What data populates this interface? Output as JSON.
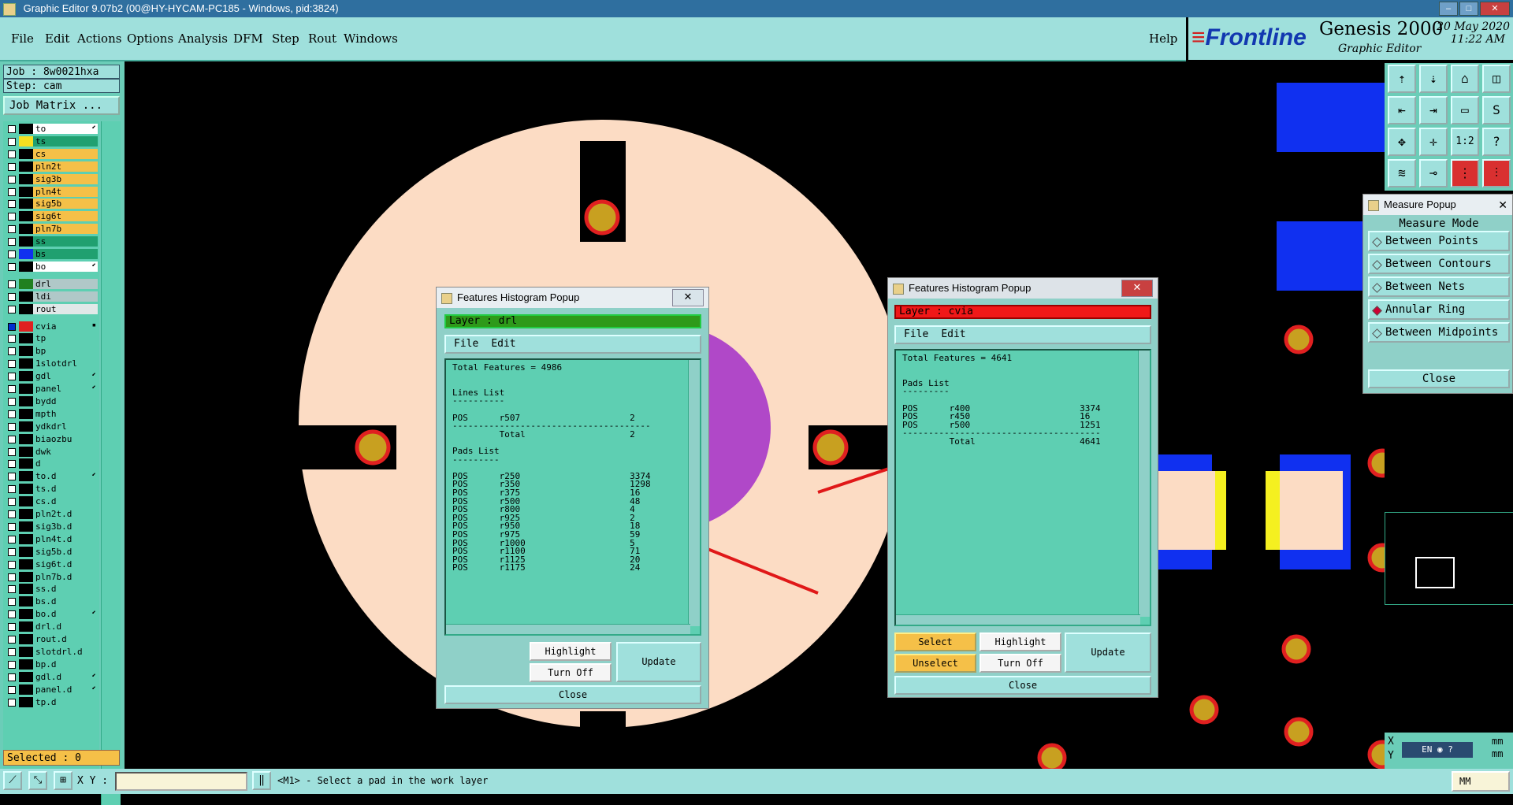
{
  "titlebar": {
    "text": "Graphic Editor 9.07b2 (00@HY-HYCAM-PC185 - Windows, pid:3824)"
  },
  "menu": {
    "items": [
      "File",
      "Edit",
      "Actions",
      "Options",
      "Analysis",
      "DFM",
      "Step",
      "Rout",
      "Windows"
    ],
    "help": "Help"
  },
  "brand": {
    "logo": "Frontline",
    "product": "Genesis 2000",
    "subtitle": "Graphic Editor",
    "date": "20 May 2020",
    "time": "11:22 AM"
  },
  "job": {
    "job_label": "Job  :  8w0021hxa",
    "step_label": "Step:  cam",
    "matrix_button": "Job Matrix ..."
  },
  "layers": [
    {
      "name": "to",
      "swatch": "#000000",
      "bg": "#ffffff",
      "mark": "⬋"
    },
    {
      "name": "ts",
      "swatch": "#f5e020",
      "bg": "#20a070",
      "mark": ""
    },
    {
      "name": "cs",
      "swatch": "#000000",
      "bg": "#f5c048",
      "mark": ""
    },
    {
      "name": "pln2t",
      "swatch": "#000000",
      "bg": "#f5c048",
      "mark": ""
    },
    {
      "name": "sig3b",
      "swatch": "#000000",
      "bg": "#f5c048",
      "mark": ""
    },
    {
      "name": "pln4t",
      "swatch": "#000000",
      "bg": "#f5c048",
      "mark": ""
    },
    {
      "name": "sig5b",
      "swatch": "#000000",
      "bg": "#f5c048",
      "mark": ""
    },
    {
      "name": "sig6t",
      "swatch": "#000000",
      "bg": "#f5c048",
      "mark": ""
    },
    {
      "name": "pln7b",
      "swatch": "#000000",
      "bg": "#f5c048",
      "mark": ""
    },
    {
      "name": "ss",
      "swatch": "#000000",
      "bg": "#20a070",
      "mark": ""
    },
    {
      "name": "bs",
      "swatch": "#1030f0",
      "bg": "#20a070",
      "mark": ""
    },
    {
      "name": "bo",
      "swatch": "#000000",
      "bg": "#ffffff",
      "mark": "⬋"
    },
    {
      "name": "drl",
      "swatch": "#208020",
      "bg": "#b0c8c8",
      "mark": ""
    },
    {
      "name": "ldi",
      "swatch": "#000000",
      "bg": "#b0c8c8",
      "mark": ""
    },
    {
      "name": "rout",
      "swatch": "#000000",
      "bg": "#e0e8e8",
      "mark": ""
    },
    {
      "name": "cvia",
      "swatch": "#e02020",
      "bg": "#5ecfb2",
      "mark": "▪"
    },
    {
      "name": "tp",
      "swatch": "#000000",
      "bg": "#5ecfb2",
      "mark": ""
    },
    {
      "name": "bp",
      "swatch": "#000000",
      "bg": "#5ecfb2",
      "mark": ""
    },
    {
      "name": "1slotdrl",
      "swatch": "#000000",
      "bg": "#5ecfb2",
      "mark": ""
    },
    {
      "name": "gdl",
      "swatch": "#000000",
      "bg": "#5ecfb2",
      "mark": "⬋"
    },
    {
      "name": "panel",
      "swatch": "#000000",
      "bg": "#5ecfb2",
      "mark": "⬋"
    },
    {
      "name": "bydd",
      "swatch": "#000000",
      "bg": "#5ecfb2",
      "mark": ""
    },
    {
      "name": "mpth",
      "swatch": "#000000",
      "bg": "#5ecfb2",
      "mark": ""
    },
    {
      "name": "ydkdrl",
      "swatch": "#000000",
      "bg": "#5ecfb2",
      "mark": ""
    },
    {
      "name": "biaozbu",
      "swatch": "#000000",
      "bg": "#5ecfb2",
      "mark": ""
    },
    {
      "name": "dwk",
      "swatch": "#000000",
      "bg": "#5ecfb2",
      "mark": ""
    },
    {
      "name": "d",
      "swatch": "#000000",
      "bg": "#5ecfb2",
      "mark": ""
    },
    {
      "name": "to.d",
      "swatch": "#000000",
      "bg": "#5ecfb2",
      "mark": "⬋"
    },
    {
      "name": "ts.d",
      "swatch": "#000000",
      "bg": "#5ecfb2",
      "mark": ""
    },
    {
      "name": "cs.d",
      "swatch": "#000000",
      "bg": "#5ecfb2",
      "mark": ""
    },
    {
      "name": "pln2t.d",
      "swatch": "#000000",
      "bg": "#5ecfb2",
      "mark": ""
    },
    {
      "name": "sig3b.d",
      "swatch": "#000000",
      "bg": "#5ecfb2",
      "mark": ""
    },
    {
      "name": "pln4t.d",
      "swatch": "#000000",
      "bg": "#5ecfb2",
      "mark": ""
    },
    {
      "name": "sig5b.d",
      "swatch": "#000000",
      "bg": "#5ecfb2",
      "mark": ""
    },
    {
      "name": "sig6t.d",
      "swatch": "#000000",
      "bg": "#5ecfb2",
      "mark": ""
    },
    {
      "name": "pln7b.d",
      "swatch": "#000000",
      "bg": "#5ecfb2",
      "mark": ""
    },
    {
      "name": "ss.d",
      "swatch": "#000000",
      "bg": "#5ecfb2",
      "mark": ""
    },
    {
      "name": "bs.d",
      "swatch": "#000000",
      "bg": "#5ecfb2",
      "mark": ""
    },
    {
      "name": "bo.d",
      "swatch": "#000000",
      "bg": "#5ecfb2",
      "mark": "⬋"
    },
    {
      "name": "drl.d",
      "swatch": "#000000",
      "bg": "#5ecfb2",
      "mark": ""
    },
    {
      "name": "rout.d",
      "swatch": "#000000",
      "bg": "#5ecfb2",
      "mark": ""
    },
    {
      "name": "slotdrl.d",
      "swatch": "#000000",
      "bg": "#5ecfb2",
      "mark": ""
    },
    {
      "name": "bp.d",
      "swatch": "#000000",
      "bg": "#5ecfb2",
      "mark": ""
    },
    {
      "name": "gdl.d",
      "swatch": "#000000",
      "bg": "#5ecfb2",
      "mark": "⬋"
    },
    {
      "name": "panel.d",
      "swatch": "#000000",
      "bg": "#5ecfb2",
      "mark": "⬋"
    },
    {
      "name": "tp.d",
      "swatch": "#000000",
      "bg": "#5ecfb2",
      "mark": ""
    }
  ],
  "selected": "Selected : 0",
  "popup1": {
    "title": "Features Histogram Popup",
    "layer": "Layer :  drl",
    "menu": [
      "File",
      "Edit"
    ],
    "lines": [
      "Total Features = 4986",
      "",
      "",
      "Lines List",
      "----------",
      "",
      "POS      r507                     2",
      "--------------------------------------",
      "         Total                    2",
      "",
      "Pads List",
      "---------",
      "",
      "POS      r250                     3374",
      "POS      r350                     1298",
      "POS      r375                     16",
      "POS      r500                     48",
      "POS      r800                     4",
      "POS      r925                     2",
      "POS      r950                     18",
      "POS      r975                     59",
      "POS      r1000                    5",
      "POS      r1100                    71",
      "POS      r1125                    20",
      "POS      r1175                    24"
    ],
    "buttons": {
      "highlight": "Highlight",
      "turnoff": "Turn Off",
      "update": "Update",
      "close": "Close"
    }
  },
  "popup2": {
    "title": "Features Histogram Popup",
    "layer": "Layer :  cvia",
    "menu": [
      "File",
      "Edit"
    ],
    "lines": [
      "Total Features = 4641",
      "",
      "",
      "Pads List",
      "---------",
      "",
      "POS      r400                     3374",
      "POS      r450                     16",
      "POS      r500                     1251",
      "--------------------------------------",
      "         Total                    4641"
    ],
    "buttons": {
      "select": "Select",
      "unselect": "Unselect",
      "highlight": "Highlight",
      "turnoff": "Turn Off",
      "update": "Update",
      "close": "Close"
    }
  },
  "measure": {
    "title": "Measure Popup",
    "mode_label": "Measure Mode",
    "options": [
      "Between Points",
      "Between Contours",
      "Between Nets",
      "Annular Ring",
      "Between Midpoints"
    ],
    "selected": "Annular Ring",
    "close": "Close"
  },
  "coords": {
    "x_label": "X",
    "y_label": "Y",
    "x_unit": "mm",
    "y_unit": "mm",
    "ime": "EN"
  },
  "status": {
    "xy_label": "X Y :",
    "prompt": "<M1> - Select a pad in the work layer",
    "units": "MM"
  },
  "colors": {
    "teal": "#5ecfb2",
    "menu": "#9fe0dc",
    "board": "#fcdcc4",
    "pad": "#e02020",
    "padcore": "#c8a020",
    "blue": "#1030f0",
    "purple": "#b048c8",
    "yellow": "#f5f020"
  }
}
